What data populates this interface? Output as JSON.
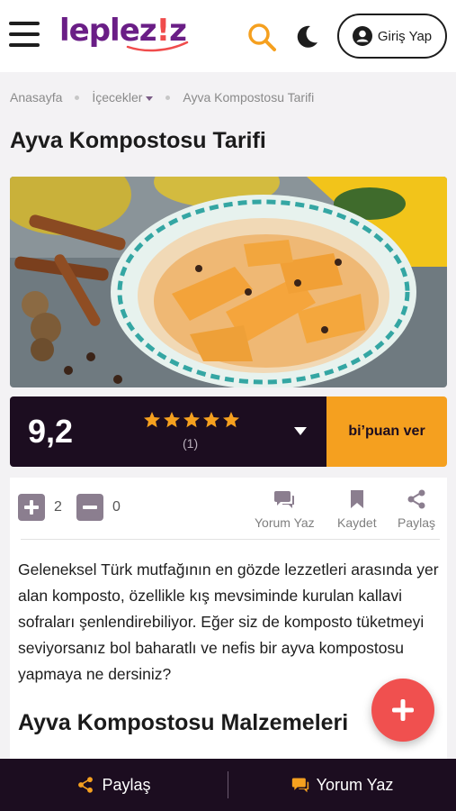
{
  "header": {
    "logo_main": "leplez",
    "logo_bang": "!",
    "logo_tail": "z",
    "login_label": "Giriş Yap",
    "icons": [
      "menu-icon",
      "search-icon",
      "moon-icon",
      "user-icon"
    ]
  },
  "breadcrumb": [
    "Anasayfa",
    "İçecekler",
    "Ayva Kompostosu Tarifi"
  ],
  "page_title": "Ayva Kompostosu Tarifi",
  "rating": {
    "score": "9,2",
    "stars": 5,
    "count": "(1)",
    "rate_label": "bi’puan ver"
  },
  "votes": {
    "up": "2",
    "down": "0"
  },
  "actions": {
    "comment": "Yorum Yaz",
    "save": "Kaydet",
    "share": "Paylaş"
  },
  "intro_text": "Geleneksel Türk mutfağının en gözde lezzetleri arasında yer alan komposto, özellikle kış mevsiminde kurulan kallavi sofraları şenlendirebiliyor. Eğer siz de komposto tüketmeyi seviyorsanız bol baharatlı ve nefis bir ayva kompostosu yapmaya ne dersiniz?",
  "section_heading": "Ayva Kompostosu Malzemeleri",
  "bottom_bar": {
    "share": "Paylaş",
    "comment": "Yorum Yaz"
  },
  "colors": {
    "brand_purple": "#6a1e86",
    "dark": "#1c0d20",
    "orange": "#f5a01f",
    "fab_red": "#f0504f"
  }
}
